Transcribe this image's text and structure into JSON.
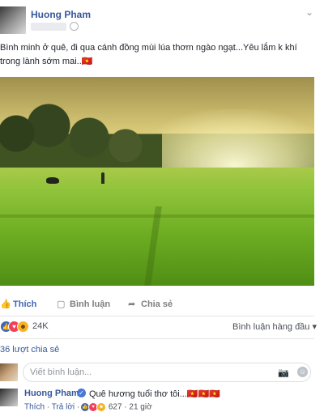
{
  "post": {
    "author": "Huong Pham",
    "text": "Bình minh ở quê, đi qua cánh đồng mùi lúa thơm ngào ngạt...Yêu lắm k khí trong lành sớm mai..🇻🇳"
  },
  "actions": {
    "like": "Thích",
    "comment": "Bình luận",
    "share": "Chia sẻ"
  },
  "reactions": {
    "count": "24K",
    "sort_label": "Bình luận hàng đầu ▾"
  },
  "shares": "36 lượt chia sẻ",
  "comment_box": {
    "placeholder": "Viết bình luận..."
  },
  "reply": {
    "author": "Huong Pham",
    "text": "Quê hương tuổi thơ tôi...🇻🇳🇻🇳🇻🇳",
    "like": "Thích",
    "reply": "Trả lời",
    "count": "627",
    "time": "21 giờ"
  },
  "icons": {
    "like": "thumbs-up-icon",
    "comment": "comment-icon",
    "share": "share-arrow-icon",
    "camera": "camera-icon",
    "emoji": "smiley-icon",
    "verified": "verified-check-icon",
    "chevron": "chevron-down-icon",
    "privacy": "globe-icon"
  },
  "colors": {
    "link": "#365899",
    "accent": "#4267b2",
    "love": "#f33e58",
    "haha": "#f7b125"
  }
}
